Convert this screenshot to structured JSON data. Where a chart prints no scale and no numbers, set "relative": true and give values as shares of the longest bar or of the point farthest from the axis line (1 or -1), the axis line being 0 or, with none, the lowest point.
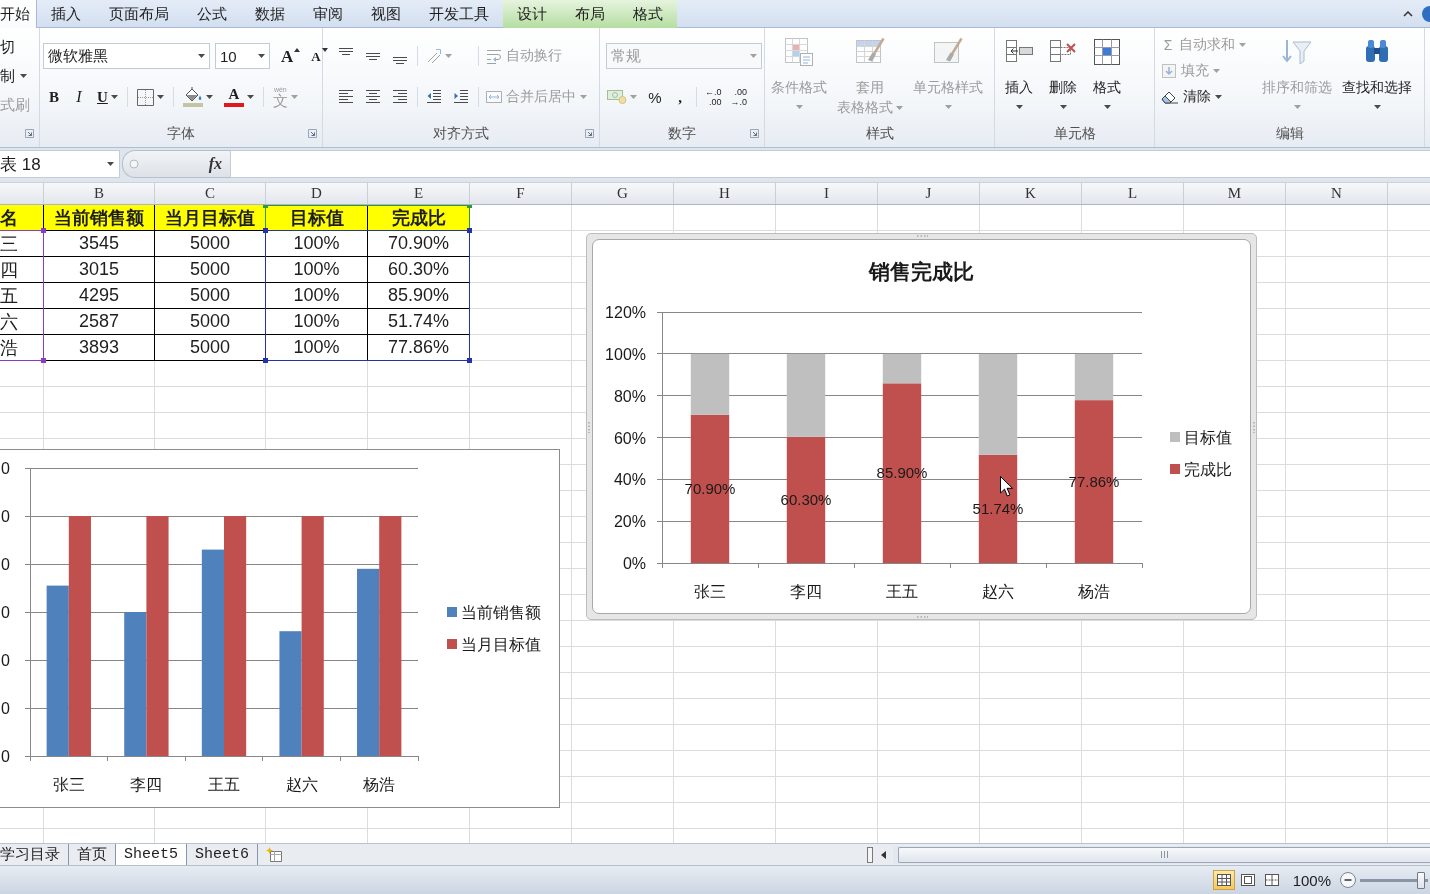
{
  "ribbon_tabs": [
    {
      "label": "开始",
      "selected": true,
      "contextual": false
    },
    {
      "label": "插入",
      "selected": false,
      "contextual": false
    },
    {
      "label": "页面布局",
      "selected": false,
      "contextual": false
    },
    {
      "label": "公式",
      "selected": false,
      "contextual": false
    },
    {
      "label": "数据",
      "selected": false,
      "contextual": false
    },
    {
      "label": "审阅",
      "selected": false,
      "contextual": false
    },
    {
      "label": "视图",
      "selected": false,
      "contextual": false
    },
    {
      "label": "开发工具",
      "selected": false,
      "contextual": false
    },
    {
      "label": "设计",
      "selected": false,
      "contextual": true
    },
    {
      "label": "布局",
      "selected": false,
      "contextual": true
    },
    {
      "label": "格式",
      "selected": false,
      "contextual": true
    }
  ],
  "ribbon_groups": [
    {
      "launcher": true,
      "rows": [
        [
          [
            {
              "kind": "text",
              "label": "切",
              "menu": false,
              "disabled": false
            }
          ]
        ],
        [
          [
            {
              "kind": "text",
              "label": "制",
              "menu": true,
              "disabled": false
            }
          ]
        ],
        [
          [
            {
              "kind": "text",
              "label": "式刷",
              "menu": false,
              "disabled": true
            }
          ]
        ]
      ]
    },
    {
      "label": "字体",
      "launcher": true,
      "rows": [
        [
          [
            {
              "kind": "combo",
              "value": "微软雅黑",
              "disabled": false
            },
            {
              "kind": "combo",
              "value": "10",
              "disabled": false
            },
            {
              "kind": "grow",
              "text": "A",
              "menu": false,
              "disabled": false
            },
            {
              "kind": "shrink",
              "text": "A",
              "menu": false,
              "disabled": false
            }
          ]
        ],
        [
          [
            {
              "kind": "bold",
              "text": "B",
              "menu": false,
              "disabled": false
            },
            {
              "kind": "italic",
              "text": "I",
              "menu": false,
              "disabled": false
            },
            {
              "kind": "underline",
              "text": "U",
              "menu": true,
              "disabled": false
            }
          ],
          [
            {
              "kind": "icon",
              "menu": true,
              "disabled": false
            }
          ],
          [
            {
              "kind": "icon",
              "color": "#c6c5a3",
              "menu": true,
              "disabled": false
            },
            {
              "kind": "bold",
              "text": "A",
              "color": "#e0181c",
              "menu": true,
              "disabled": false
            }
          ],
          [
            {
              "kind": "glyph",
              "text": "文",
              "ruby": "wén",
              "menu": true,
              "disabled": true
            }
          ]
        ]
      ]
    },
    {
      "label": "对齐方式",
      "launcher": true,
      "rows": [
        [
          [
            {
              "kind": "icon",
              "menu": false,
              "disabled": false
            },
            {
              "kind": "icon",
              "menu": false,
              "disabled": false
            },
            {
              "kind": "icon",
              "menu": false,
              "disabled": false
            }
          ],
          [
            {
              "kind": "icon",
              "menu": true,
              "disabled": true
            }
          ],
          [
            {
              "kind": "small",
              "label": "自动换行",
              "menu": false,
              "disabled": true
            }
          ]
        ],
        [
          [
            {
              "kind": "icon",
              "menu": false,
              "disabled": false
            },
            {
              "kind": "icon",
              "menu": false,
              "disabled": false
            },
            {
              "kind": "icon",
              "menu": false,
              "disabled": false
            }
          ],
          [
            {
              "kind": "icon",
              "menu": false,
              "disabled": false
            },
            {
              "kind": "icon",
              "menu": false,
              "disabled": false
            }
          ],
          [
            {
              "kind": "small",
              "label": "合并后居中",
              "menu": true,
              "disabled": true
            }
          ]
        ]
      ]
    },
    {
      "label": "数字",
      "launcher": true,
      "rows": [
        [
          [
            {
              "kind": "combo",
              "value": "常规",
              "disabled": true
            }
          ]
        ],
        [
          [
            {
              "kind": "icon",
              "menu": true,
              "disabled": true
            },
            {
              "kind": "glyph",
              "text": "%",
              "menu": false,
              "disabled": false
            },
            {
              "kind": "bold",
              "text": ",",
              "menu": false,
              "disabled": false
            }
          ],
          [
            {
              "kind": "decimal",
              "lines": [
                "←.0",
                ".00"
              ],
              "disabled": false
            },
            {
              "kind": "decimal",
              "lines": [
                ".00",
                "→.0"
              ],
              "disabled": false
            }
          ]
        ]
      ]
    },
    {
      "label": "样式",
      "launcher": false,
      "rows": [
        [
          [
            {
              "kind": "large",
              "lines": [
                "条件格式"
              ],
              "menu": true,
              "disabled": true
            },
            {
              "kind": "large",
              "lines": [
                "套用",
                "表格格式"
              ],
              "menu": true,
              "disabled": true
            },
            {
              "kind": "large",
              "lines": [
                "单元格样式"
              ],
              "menu": true,
              "disabled": true
            }
          ]
        ]
      ]
    },
    {
      "label": "单元格",
      "launcher": false,
      "rows": [
        [
          [
            {
              "kind": "large",
              "lines": [
                "插入"
              ],
              "menu": true,
              "disabled": false
            },
            {
              "kind": "large",
              "lines": [
                "删除"
              ],
              "menu": true,
              "disabled": false
            },
            {
              "kind": "large",
              "lines": [
                "格式"
              ],
              "menu": true,
              "disabled": false
            }
          ]
        ]
      ]
    },
    {
      "label": "编辑",
      "launcher": false,
      "rows": [
        [
          [
            {
              "kind": "stack",
              "items": [
                {
                  "kind": "small",
                  "glyph": "Σ",
                  "label": "自动求和",
                  "menu": true,
                  "disabled": true
                },
                {
                  "kind": "small",
                  "label": "填充",
                  "menu": true,
                  "disabled": true
                },
                {
                  "kind": "small",
                  "label": "清除",
                  "menu": true,
                  "disabled": false
                }
              ]
            },
            {
              "kind": "large",
              "lines": [
                "排序和筛选"
              ],
              "menu": true,
              "disabled": true
            },
            {
              "kind": "large",
              "lines": [
                "查找和选择"
              ],
              "menu": true,
              "disabled": false
            }
          ]
        ]
      ]
    }
  ],
  "formula_bar": {
    "name_box": "表 18",
    "function_button": "fx"
  },
  "column_headers": [
    "B",
    "C",
    "D",
    "E",
    "F",
    "G",
    "H",
    "I",
    "J",
    "K",
    "L",
    "M",
    "N"
  ],
  "table": {
    "header": [
      {
        "text": "名",
        "category_range": true,
        "series_range": false
      },
      {
        "text": "当前销售额",
        "category_range": false,
        "series_range": false
      },
      {
        "text": "当月目标值",
        "category_range": false,
        "series_range": false
      },
      {
        "text": "目标值",
        "category_range": false,
        "series_range": true
      },
      {
        "text": "完成比",
        "category_range": false,
        "series_range": true
      }
    ],
    "rows": [
      [
        "三",
        "3545",
        "5000",
        "100%",
        "70.90%"
      ],
      [
        "四",
        "3015",
        "5000",
        "100%",
        "60.30%"
      ],
      [
        "五",
        "4295",
        "5000",
        "100%",
        "85.90%"
      ],
      [
        "六",
        "2587",
        "5000",
        "100%",
        "51.74%"
      ],
      [
        "浩",
        "3893",
        "5000",
        "100%",
        "77.86%"
      ]
    ]
  },
  "charts": [
    {
      "selected": true,
      "chart_data": {
        "type": "bar",
        "title": "销售完成比",
        "categories": [
          "张三",
          "李四",
          "王五",
          "赵六",
          "杨浩"
        ],
        "stacked": true,
        "series": [
          {
            "name": "完成比",
            "color": "#c0504d",
            "values": [
              70.9,
              60.3,
              85.9,
              51.74,
              77.86
            ],
            "value_labels": [
              "70.90%",
              "60.30%",
              "85.90%",
              "51.74%",
              "77.86%"
            ]
          },
          {
            "name": "目标值",
            "color": "#bfbfbf",
            "values": [
              29.1,
              39.7,
              14.1,
              48.26,
              22.14
            ]
          }
        ],
        "ylim": [
          0,
          120
        ],
        "yticks": [
          {
            "value": 0,
            "label": "0%"
          },
          {
            "value": 20,
            "label": "20%"
          },
          {
            "value": 40,
            "label": "40%"
          },
          {
            "value": 60,
            "label": "60%"
          },
          {
            "value": 80,
            "label": "80%"
          },
          {
            "value": 100,
            "label": "100%"
          },
          {
            "value": 120,
            "label": "120%"
          }
        ],
        "grid": true,
        "legend": "right"
      }
    },
    {
      "selected": false,
      "chart_data": {
        "type": "bar",
        "categories": [
          "张三",
          "李四",
          "王五",
          "赵六",
          "杨浩"
        ],
        "series": [
          {
            "name": "当前销售额",
            "color": "#4f81bd",
            "values": [
              0.71,
              0.6,
              0.86,
              0.52,
              0.78
            ]
          },
          {
            "name": "当月目标值",
            "color": "#c0504d",
            "values": [
              1,
              1,
              1,
              1,
              1
            ]
          }
        ],
        "relative": true,
        "annotations": [
          "0",
          "0",
          "0",
          "0",
          "0",
          "0",
          "0"
        ],
        "grid": true,
        "legend": "right"
      }
    }
  ],
  "sheet_tabs": [
    {
      "label": "学习目录",
      "selected": false
    },
    {
      "label": "首页",
      "selected": false
    },
    {
      "label": "Sheet5",
      "selected": true
    },
    {
      "label": "Sheet6",
      "selected": false
    }
  ],
  "status_bar": {
    "views": [
      {
        "selected": true
      },
      {
        "selected": false
      },
      {
        "selected": false
      }
    ],
    "zoom": "100%",
    "zoom_slider": {
      "level": 0.89
    }
  }
}
